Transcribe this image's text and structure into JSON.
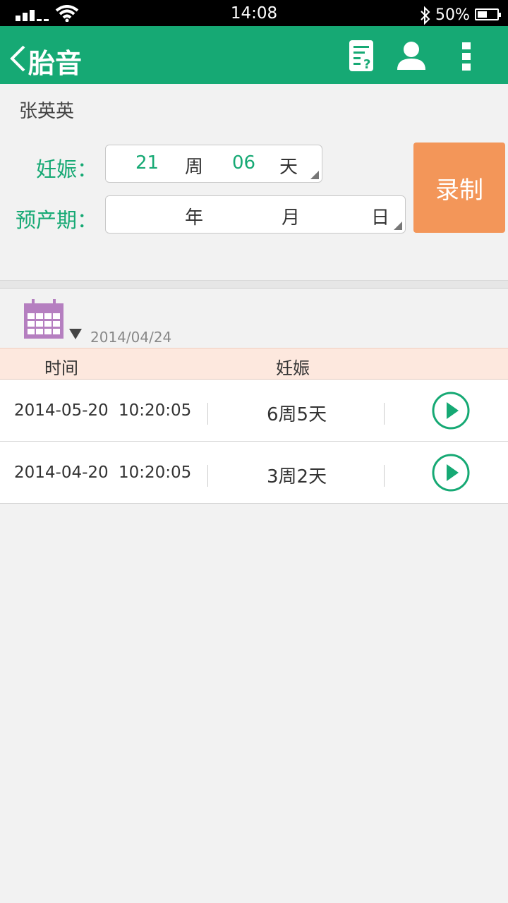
{
  "status": {
    "time": "14:08",
    "battery": "50%",
    "battery_level": 0.5
  },
  "appbar": {
    "title": "胎音",
    "actions": [
      "document-question-icon",
      "user-icon",
      "more-vertical-icon"
    ]
  },
  "patient": {
    "name": "张英英"
  },
  "pregnancy": {
    "label": "妊娠：",
    "weeks": "21",
    "weeks_unit": "周",
    "days": "06",
    "days_unit": "天"
  },
  "due_date": {
    "label": "预产期：",
    "year": "",
    "year_unit": "年",
    "month": "",
    "month_unit": "月",
    "day": "",
    "day_unit": "日"
  },
  "record_button": "录制",
  "filter": {
    "date": "2014/04/24",
    "icon": "calendar-icon"
  },
  "table": {
    "headers": [
      "时间",
      "妊娠"
    ],
    "rows": [
      {
        "date": "2014-05-20",
        "time": "10:20:05",
        "pregnancy": "6周5天"
      },
      {
        "date": "2014-04-20",
        "time": "10:20:05",
        "pregnancy": "3周2天"
      }
    ]
  },
  "colors": {
    "primary": "#16a974",
    "accent": "#f39659",
    "header_bg": "#fde8de",
    "calendar": "#b57fc0"
  }
}
